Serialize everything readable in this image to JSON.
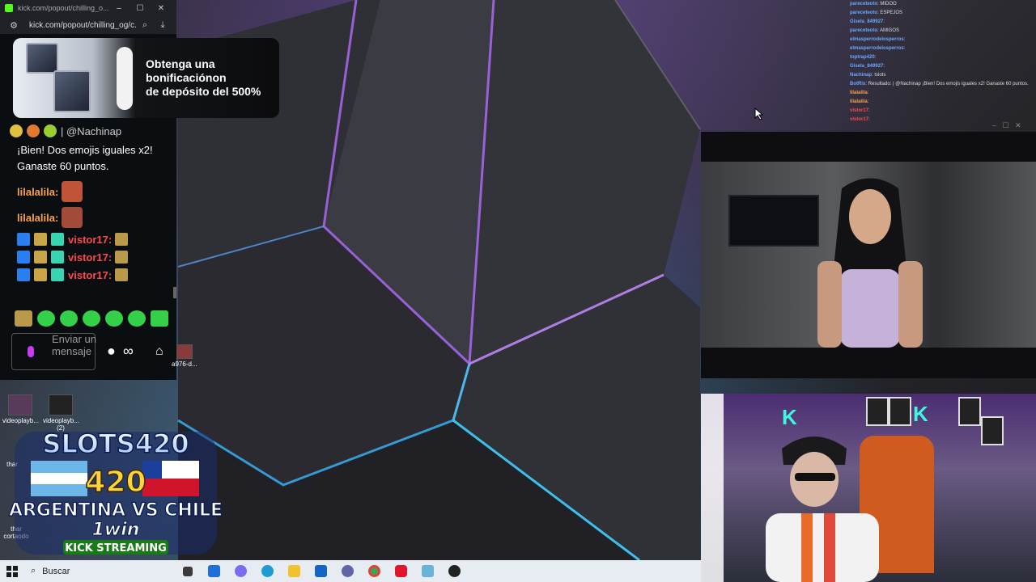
{
  "popout": {
    "title": "kick.com/popout/chilling_o...",
    "url": "kick.com/popout/chilling_og/c...",
    "promo_text": "Obtenga una\nbonificaciónon\nde depósito del 500%",
    "chat_top_fragment": "| @Nachinap",
    "bot_message": "¡Bien! Dos emojis iguales x2! Ganaste 60 puntos.",
    "messages": [
      {
        "user": "lilalalila:",
        "color": "#f9a14a"
      },
      {
        "user": "lilalalila:",
        "color": "#f9a14a"
      },
      {
        "user": "vistor17:",
        "color": "#ff4a4a"
      },
      {
        "user": "vistor17:",
        "color": "#ff4a4a"
      },
      {
        "user": "vistor17:",
        "color": "#ff4a4a"
      }
    ],
    "input_placeholder": "Enviar un mensaje",
    "infinity_symbol": "∞"
  },
  "right_chat": {
    "lines": [
      {
        "user": "pareceteoto",
        "text": ": MIDOO"
      },
      {
        "user": "pareceteoto",
        "text": ": ESPEJOS"
      },
      {
        "user": "Gisela_849927",
        "text": ":"
      },
      {
        "user": "pareceteoto",
        "text": ": AMIGOS"
      },
      {
        "user": "elmasperrodelosperros",
        "text": ":"
      },
      {
        "user": "elmasperrodelosperros",
        "text": ":"
      },
      {
        "user": "toptrap420",
        "text": ":"
      },
      {
        "user": "Gisela_849927",
        "text": ":"
      },
      {
        "user": "Nachinap",
        "text": ": tslots"
      },
      {
        "user": "BotRix",
        "text": ": Resultado: | @Nachinap ¡Bien! Dos emojis iguales x2! Ganaste 60 puntos."
      },
      {
        "user": "lilalalila",
        "text": ":"
      },
      {
        "user": "lilalalila",
        "text": ":"
      },
      {
        "user": "vistor17",
        "text": ":"
      },
      {
        "user": "vistor17",
        "text": ":"
      }
    ]
  },
  "desktop_icons": [
    {
      "label": "videoplayb..."
    },
    {
      "label": "videoplayb... (2)"
    },
    {
      "label": "a976-d..."
    },
    {
      "label": "thar"
    },
    {
      "label": "thar cortaodo"
    }
  ],
  "logo": {
    "line1": "SLOTS420",
    "line2": "420",
    "line3": "ARGENTINA VS CHILE",
    "line4": "1win",
    "line5": "KICK STREAMING"
  },
  "taskbar": {
    "search_label": "Buscar",
    "apps": [
      "task-view",
      "store",
      "copilot",
      "edge",
      "explorer",
      "outlook",
      "teams",
      "chrome",
      "opera",
      "notepad",
      "obs"
    ]
  },
  "colors": {
    "kick_green": "#53fc18",
    "username_orange": "#f9a14a",
    "username_red": "#ff4a4a",
    "taskbar_bg": "#e7ecf3"
  }
}
